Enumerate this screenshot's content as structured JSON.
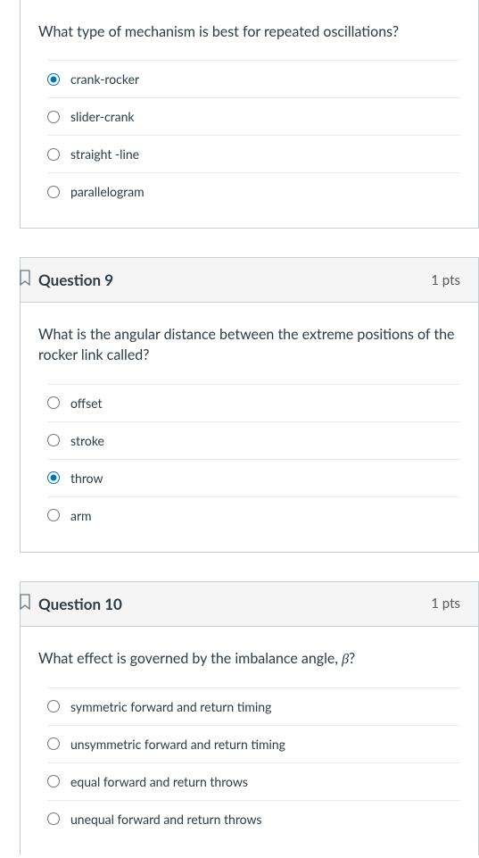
{
  "q8": {
    "prompt": "What type of mechanism is best for repeated oscillations?",
    "options": [
      "crank-rocker",
      "slider-crank",
      "straight -line",
      "parallelogram"
    ],
    "selected": 0
  },
  "q9": {
    "title": "Question 9",
    "points": "1 pts",
    "prompt": "What is the angular distance between the extreme positions of the rocker link called?",
    "options": [
      "offset",
      "stroke",
      "throw",
      "arm"
    ],
    "selected": 2
  },
  "q10": {
    "title": "Question 10",
    "points": "1 pts",
    "prompt_before": "What effect is governed by the imbalance angle, ",
    "prompt_beta": "β",
    "prompt_after": "?",
    "options": [
      "symmetric forward and return timing",
      "unsymmetric forward and return timing",
      "equal forward and return throws",
      "unequal forward and return throws"
    ],
    "selected": -1
  }
}
